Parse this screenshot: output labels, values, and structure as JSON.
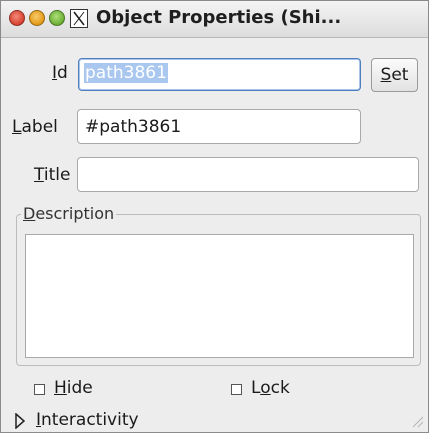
{
  "window": {
    "title": "Object Properties (Shi..."
  },
  "fields": {
    "id": {
      "label_mnemonic": "I",
      "label_rest": "d",
      "value": "path3861",
      "button_mnemonic": "S",
      "button_rest": "et"
    },
    "label": {
      "label_mnemonic": "L",
      "label_rest": "abel",
      "value": "#path3861"
    },
    "title": {
      "label_mnemonic": "T",
      "label_rest": "itle",
      "value": ""
    },
    "description": {
      "label_mnemonic": "D",
      "label_rest": "escription",
      "value": ""
    }
  },
  "checks": {
    "hide": {
      "mnemonic": "H",
      "rest": "ide",
      "checked": false
    },
    "lock": {
      "prefix": "L",
      "mnemonic": "o",
      "rest": "ck",
      "checked": false
    }
  },
  "interactivity": {
    "mnemonic": "I",
    "rest": "nteractivity",
    "expanded": false
  },
  "icons": [
    "close-icon",
    "minimize-icon",
    "maximize-icon",
    "x11-app-icon",
    "expander-arrow-icon",
    "resize-grip-icon"
  ]
}
